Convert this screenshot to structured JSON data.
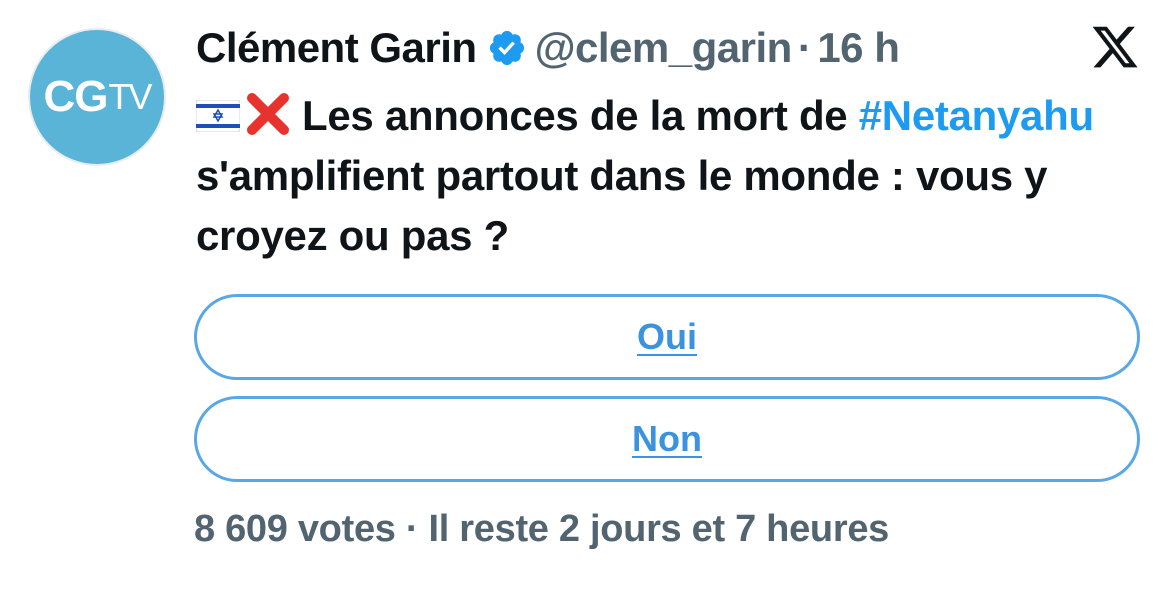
{
  "author": {
    "name": "Clément Garin",
    "handle": "@clem_garin",
    "separator": "·",
    "time": "16 h",
    "avatar_text_main": "CG",
    "avatar_text_sub": "TV"
  },
  "tweet": {
    "text_before": "Les annonces de la mort de",
    "hashtag": "#Netanyahu",
    "text_after": "s'amplifient partout dans le monde : vous y croyez ou pas ?"
  },
  "poll": {
    "options": [
      {
        "label": "Oui"
      },
      {
        "label": "Non"
      }
    ],
    "votes": "8 609 votes",
    "separator": "·",
    "remaining": "Il reste 2 jours et 7 heures"
  },
  "icons": {
    "verified": "verified-badge-icon",
    "flag": "israel-flag-icon",
    "cross": "red-cross-mark-icon",
    "logo": "x-logo-icon"
  },
  "colors": {
    "accent": "#1d9bf0",
    "poll_border": "#5aa7e6",
    "muted": "#536471",
    "avatar_bg": "#5ab4d8",
    "cross": "#e8322e"
  }
}
